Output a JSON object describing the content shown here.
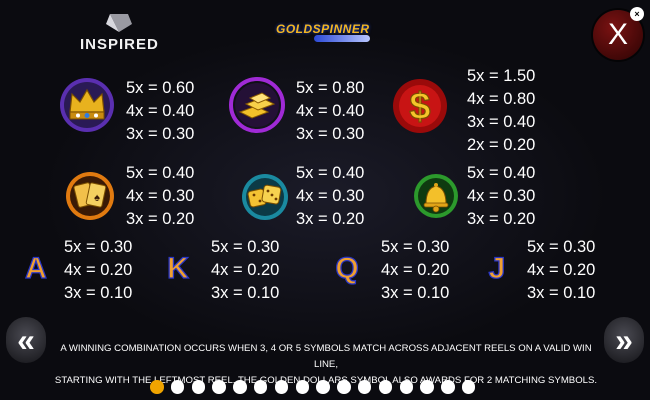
{
  "brand": {
    "name": "INSPIRED"
  },
  "game_logo": {
    "title": "GOLDSPINNER"
  },
  "close_button": {
    "label": "X",
    "badge": "×"
  },
  "paytable": {
    "symbols": [
      {
        "icon": "crown-icon",
        "payouts": [
          "5x = 0.60",
          "4x = 0.40",
          "3x = 0.30"
        ]
      },
      {
        "icon": "gold-bars-icon",
        "payouts": [
          "5x = 0.80",
          "4x = 0.40",
          "3x = 0.30"
        ]
      },
      {
        "icon": "golden-dollar-icon",
        "payouts": [
          "5x = 1.50",
          "4x = 0.80",
          "3x = 0.40",
          "2x = 0.20"
        ]
      },
      {
        "icon": "playing-cards-icon",
        "payouts": [
          "5x = 0.40",
          "4x = 0.30",
          "3x = 0.20"
        ]
      },
      {
        "icon": "dice-icon",
        "payouts": [
          "5x = 0.40",
          "4x = 0.30",
          "3x = 0.20"
        ]
      },
      {
        "icon": "golden-bell-icon",
        "payouts": [
          "5x = 0.40",
          "4x = 0.30",
          "3x = 0.20"
        ]
      }
    ],
    "letters": [
      {
        "letter": "A",
        "payouts": [
          "5x = 0.30",
          "4x = 0.20",
          "3x = 0.10"
        ]
      },
      {
        "letter": "K",
        "payouts": [
          "5x = 0.30",
          "4x = 0.20",
          "3x = 0.10"
        ]
      },
      {
        "letter": "Q",
        "payouts": [
          "5x = 0.30",
          "4x = 0.20",
          "3x = 0.10"
        ]
      },
      {
        "letter": "J",
        "payouts": [
          "5x = 0.30",
          "4x = 0.20",
          "3x = 0.10"
        ]
      }
    ]
  },
  "description": {
    "line1": "A WINNING COMBINATION OCCURS WHEN 3, 4 OR 5 SYMBOLS MATCH ACROSS ADJACENT REELS ON A VALID WIN LINE,",
    "line2": "STARTING WITH THE LEFTMOST REEL. THE GOLDEN DOLLARS SYMBOL ALSO AWARDS FOR 2 MATCHING SYMBOLS."
  },
  "navigation": {
    "prev_label": "«",
    "next_label": "»"
  },
  "pager": {
    "total_pages": 16,
    "current_page": 1
  },
  "colors": {
    "accent": "#f0a400",
    "letter_fill": "#f0a030",
    "letter_outline": "#2a37c8",
    "close_bg": "#5a0a0a"
  }
}
